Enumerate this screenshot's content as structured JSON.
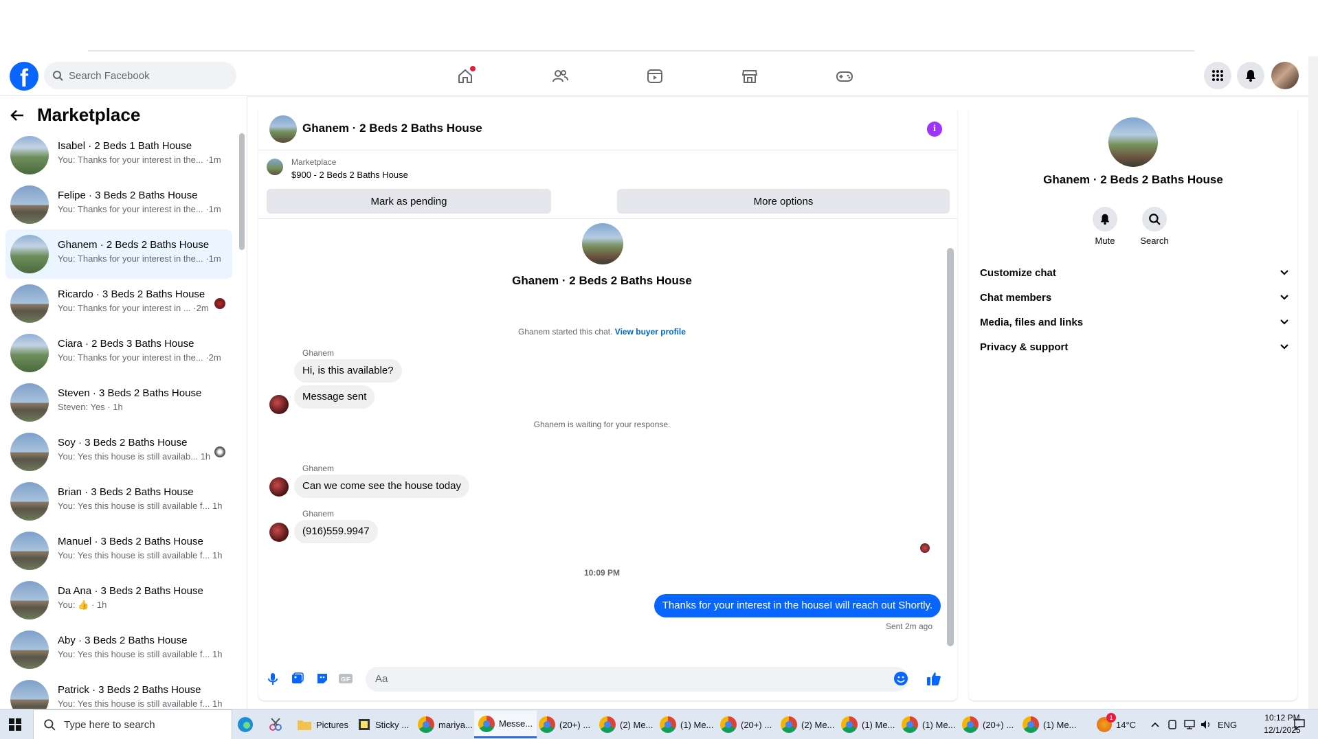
{
  "header": {
    "search_placeholder": "Search Facebook"
  },
  "left": {
    "title": "Marketplace",
    "conversations": [
      {
        "name": "Isabel · 2 Beds 1 Bath House",
        "preview": "You: Thanks for your interest in the... ·1m"
      },
      {
        "name": "Felipe · 3 Beds 2 Baths House",
        "preview": "You: Thanks for your interest in the... ·1m"
      },
      {
        "name": "Ghanem · 2 Beds 2 Baths House",
        "preview": "You: Thanks for your interest in the... ·1m"
      },
      {
        "name": "Ricardo · 3 Beds 2 Baths House",
        "preview": "You: Thanks for your interest in ... ·2m"
      },
      {
        "name": "Ciara · 2 Beds 3 Baths House",
        "preview": "You: Thanks for your interest in the... ·2m"
      },
      {
        "name": "Steven · 3 Beds 2 Baths House",
        "preview": "Steven: Yes · 1h"
      },
      {
        "name": "Soy · 3 Beds 2 Baths House",
        "preview": "You: Yes this house is still availab... 1h"
      },
      {
        "name": "Brian · 3 Beds 2 Baths House",
        "preview": "You: Yes this house is still available f... 1h"
      },
      {
        "name": "Manuel · 3 Beds 2 Baths House",
        "preview": "You: Yes this house is still available f... 1h"
      },
      {
        "name": "Da Ana · 3 Beds 2 Baths House",
        "preview": "You: 👍 · 1h"
      },
      {
        "name": "Aby · 3 Beds 2 Baths House",
        "preview": "You: Yes this house is still available f... 1h"
      },
      {
        "name": "Patrick · 3 Beds 2 Baths House",
        "preview": "You: Yes this house is still available f... 1h"
      }
    ]
  },
  "chat": {
    "title": "Ghanem · 2 Beds 2 Baths House",
    "marketplace_label": "Marketplace",
    "listing": "$900 - 2 Beds 2 Baths House",
    "mark_pending": "Mark as pending",
    "more_options": "More options",
    "intro_name": "Ghanem · 2 Beds 2 Baths House",
    "started_text": "Ghanem started this chat.",
    "view_buyer": "View buyer profile",
    "sender": "Ghanem",
    "msg1": "Hi, is this available?",
    "msg2": "Message sent",
    "waiting": "Ghanem is waiting for your response.",
    "msg3": "Can we come see the house today",
    "msg4": "(916)559.9947",
    "time": "10:09 PM",
    "my_msg": "Thanks for your interest in the houseI will reach out Shortly.",
    "sent_status": "Sent 2m ago",
    "input_placeholder": "Aa"
  },
  "details": {
    "name": "Ghanem · 2 Beds 2 Baths House",
    "mute": "Mute",
    "search": "Search",
    "sections": [
      "Customize chat",
      "Chat members",
      "Media, files and links",
      "Privacy & support"
    ]
  },
  "taskbar": {
    "search": "Type here to search",
    "items": [
      "Pictures",
      "Sticky ...",
      "mariya...",
      "Messe...",
      "(20+) ...",
      "(2) Me...",
      "(1) Me...",
      "(20+) ...",
      "(2) Me...",
      "(1) Me...",
      "(1) Me...",
      "(20+) ...",
      "(1) Me..."
    ],
    "temp": "14°C",
    "lang": "ENG",
    "time": "10:12 PM",
    "date": "12/1/2025",
    "weather_badge": "1"
  },
  "colors": {
    "fb_blue": "#0866ff",
    "info_purple": "#a033ff",
    "active_row": "#ebf5ff"
  }
}
